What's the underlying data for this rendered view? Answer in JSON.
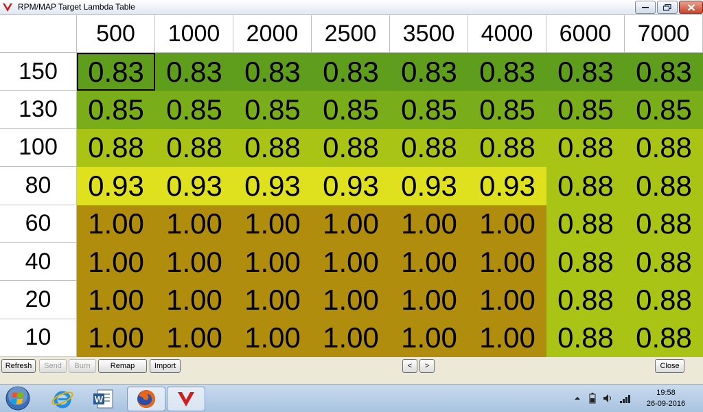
{
  "window": {
    "title": "RPM/MAP Target Lambda Table"
  },
  "table": {
    "columns": [
      "500",
      "1000",
      "2000",
      "2500",
      "3500",
      "4000",
      "6000",
      "7000"
    ],
    "rows": [
      {
        "label": "150",
        "values": [
          "0.83",
          "0.83",
          "0.83",
          "0.83",
          "0.83",
          "0.83",
          "0.83",
          "0.83"
        ]
      },
      {
        "label": "130",
        "values": [
          "0.85",
          "0.85",
          "0.85",
          "0.85",
          "0.85",
          "0.85",
          "0.85",
          "0.85"
        ]
      },
      {
        "label": "100",
        "values": [
          "0.88",
          "0.88",
          "0.88",
          "0.88",
          "0.88",
          "0.88",
          "0.88",
          "0.88"
        ]
      },
      {
        "label": "80",
        "values": [
          "0.93",
          "0.93",
          "0.93",
          "0.93",
          "0.93",
          "0.93",
          "0.88",
          "0.88"
        ]
      },
      {
        "label": "60",
        "values": [
          "1.00",
          "1.00",
          "1.00",
          "1.00",
          "1.00",
          "1.00",
          "0.88",
          "0.88"
        ]
      },
      {
        "label": "40",
        "values": [
          "1.00",
          "1.00",
          "1.00",
          "1.00",
          "1.00",
          "1.00",
          "0.88",
          "0.88"
        ]
      },
      {
        "label": "20",
        "values": [
          "1.00",
          "1.00",
          "1.00",
          "1.00",
          "1.00",
          "1.00",
          "0.88",
          "0.88"
        ]
      },
      {
        "label": "10",
        "values": [
          "1.00",
          "1.00",
          "1.00",
          "1.00",
          "1.00",
          "1.00",
          "0.88",
          "0.88"
        ]
      }
    ],
    "value_colors": {
      "0.83": "#5f9e1c",
      "0.85": "#7aad1a",
      "0.88": "#a9c414",
      "0.93": "#dfe01e",
      "1.00": "#b08d0c"
    },
    "selected_cell": {
      "row": 0,
      "col": 0
    }
  },
  "buttons": {
    "refresh": "Refresh",
    "send": "Send",
    "burn": "Burn",
    "remap": "Remap",
    "import": "Import",
    "prev": "<",
    "next": ">",
    "close": "Close"
  },
  "taskbar": {
    "apps": [
      "start-orb",
      "internet-explorer",
      "word",
      "firefox",
      "tuner-app"
    ],
    "time": "19:58",
    "date": "26-09-2016"
  },
  "colors": {
    "accent_logo": "#cc1f1f"
  }
}
